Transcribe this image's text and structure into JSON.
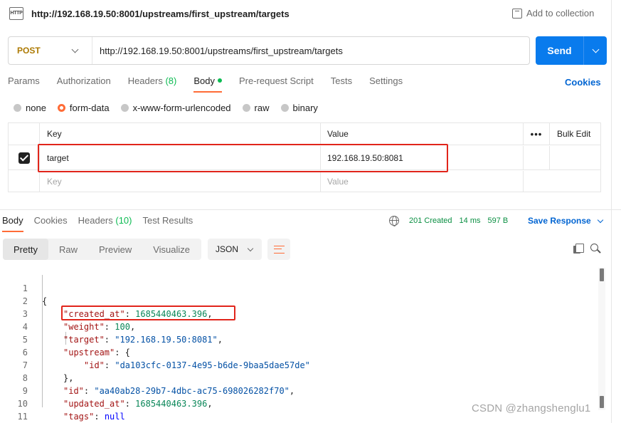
{
  "request": {
    "icon_text": "HTTP",
    "title": "http://192.168.19.50:8001/upstreams/first_upstream/targets",
    "add_to_collection": "Add to collection",
    "method": "POST",
    "url": "http://192.168.19.50:8001/upstreams/first_upstream/targets",
    "send_label": "Send"
  },
  "request_tabs": {
    "params": "Params",
    "authorization": "Authorization",
    "headers": "Headers",
    "headers_count": "(8)",
    "body": "Body",
    "pre_request": "Pre-request Script",
    "tests": "Tests",
    "settings": "Settings",
    "cookies": "Cookies"
  },
  "body_modes": {
    "none": "none",
    "form_data": "form-data",
    "urlencoded": "x-www-form-urlencoded",
    "raw": "raw",
    "binary": "binary",
    "selected": "form-data"
  },
  "form_table": {
    "key_header": "Key",
    "value_header": "Value",
    "more": "•••",
    "bulk_edit": "Bulk Edit",
    "rows": [
      {
        "key": "target",
        "value": "192.168.19.50:8081",
        "checked": true
      }
    ],
    "key_placeholder": "Key",
    "value_placeholder": "Value"
  },
  "response_tabs": {
    "body": "Body",
    "cookies": "Cookies",
    "headers": "Headers",
    "headers_count": "(10)",
    "test_results": "Test Results"
  },
  "response_status": {
    "status": "201 Created",
    "time": "14 ms",
    "size": "597 B",
    "save_response": "Save Response"
  },
  "view": {
    "pretty": "Pretty",
    "raw": "Raw",
    "preview": "Preview",
    "visualize": "Visualize",
    "format": "JSON"
  },
  "response_body": {
    "lines": [
      {
        "n": "1",
        "open": "{"
      },
      {
        "n": "2",
        "key": "\"created_at\"",
        "value": "1685440463.396",
        "vtype": "n",
        "tail": ","
      },
      {
        "n": "3",
        "key": "\"weight\"",
        "value": "100",
        "vtype": "n",
        "tail": ","
      },
      {
        "n": "4",
        "key": "\"target\"",
        "value": "\"192.168.19.50:8081\"",
        "vtype": "s",
        "tail": ","
      },
      {
        "n": "5",
        "key": "\"upstream\"",
        "value": "{",
        "vtype": "p",
        "tail": ""
      },
      {
        "n": "6",
        "key": "\"id\"",
        "value": "\"da103cfc-0137-4e95-b6de-9baa5dae57de\"",
        "vtype": "s",
        "tail": ""
      },
      {
        "n": "7",
        "close": "},"
      },
      {
        "n": "8",
        "key": "\"id\"",
        "value": "\"aa40ab28-29b7-4dbc-ac75-698026282f70\"",
        "vtype": "s",
        "tail": ","
      },
      {
        "n": "9",
        "key": "\"updated_at\"",
        "value": "1685440463.396",
        "vtype": "n",
        "tail": ","
      },
      {
        "n": "10",
        "key": "\"tags\"",
        "value": "null",
        "vtype": "kw",
        "tail": ""
      },
      {
        "n": "11",
        "close": "}"
      }
    ]
  },
  "watermark": "CSDN @zhangshenglu1",
  "colors": {
    "accent": "#ff6c37",
    "send": "#097bed",
    "link": "#0265d2",
    "status_ok": "#0a8f42",
    "method_post": "#ad7a03",
    "annotation": "#e1251b"
  }
}
